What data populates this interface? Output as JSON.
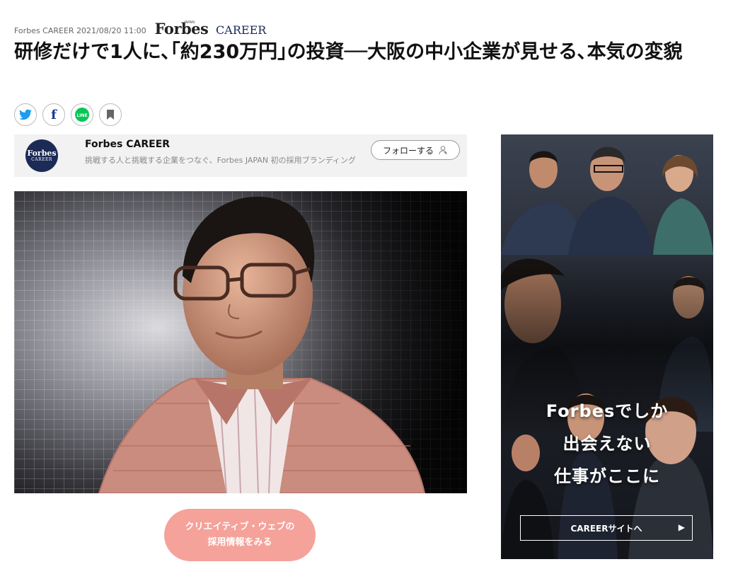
{
  "meta": {
    "source": "Forbes CAREER",
    "datetime": "2021/08/20 11:00"
  },
  "brand_logo": {
    "forbes": "Forbes",
    "career": "CAREER",
    "japan": "JAPAN"
  },
  "article": {
    "title": "研修だけで1人に､｢約230万円｣の投資──大阪の中小企業が見せる､本気の変貌"
  },
  "share": {
    "twitter_icon": "twitter-bird-icon",
    "facebook_glyph": "f",
    "line_glyph": "LINE",
    "bookmark_icon": "bookmark-icon"
  },
  "author": {
    "name": "Forbes CAREER",
    "description": "挑戦する人と挑戦する企業をつなぐ、Forbes JAPAN 初の採用ブランディング",
    "avatar_line1": "Forbes",
    "avatar_line2": "CAREER",
    "follow_label": "フォローする"
  },
  "cta": {
    "line1": "クリエイティブ・ウェブの",
    "line2": "採用情報をみる"
  },
  "ad": {
    "line1": "Forbesでしか",
    "line2": "出会えない",
    "line3": "仕事がここに",
    "cta_label": "CAREERサイトへ"
  },
  "colors": {
    "cta_bg": "#f4a29a",
    "twitter": "#1d9bf0",
    "facebook": "#1a3a8a",
    "line": "#06c755",
    "avatar_bg": "#1c2a56"
  }
}
